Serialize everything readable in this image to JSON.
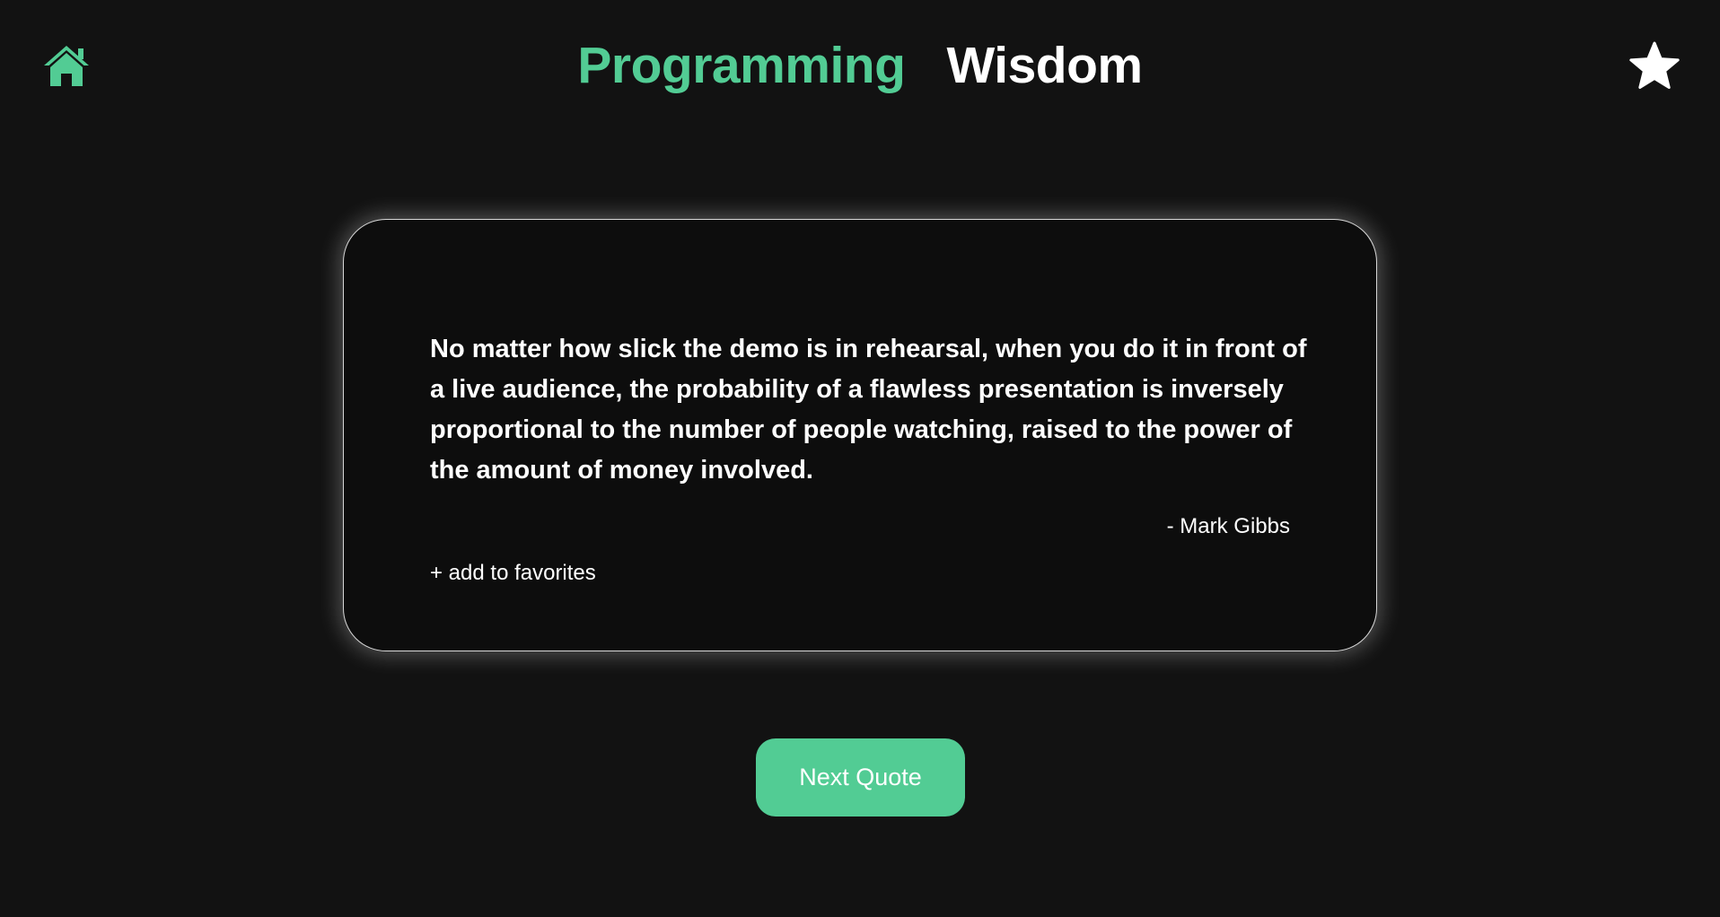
{
  "header": {
    "title_part1": "Programming",
    "title_part2": "Wisdom",
    "home_icon": "home-icon",
    "favorites_icon": "star-icon"
  },
  "quote": {
    "text": "No matter how slick the demo is in rehearsal, when you do it in front of a live audience, the probability of a flawless presentation is inversely proportional to the number of people watching, raised to the power of the amount of money involved.",
    "author": "- Mark Gibbs",
    "add_to_favorites_label": "+ add to favorites"
  },
  "actions": {
    "next_quote_label": "Next Quote"
  },
  "colors": {
    "accent": "#52cc94",
    "background": "#121212",
    "card_background": "#0d0d0d",
    "text": "#ffffff"
  }
}
